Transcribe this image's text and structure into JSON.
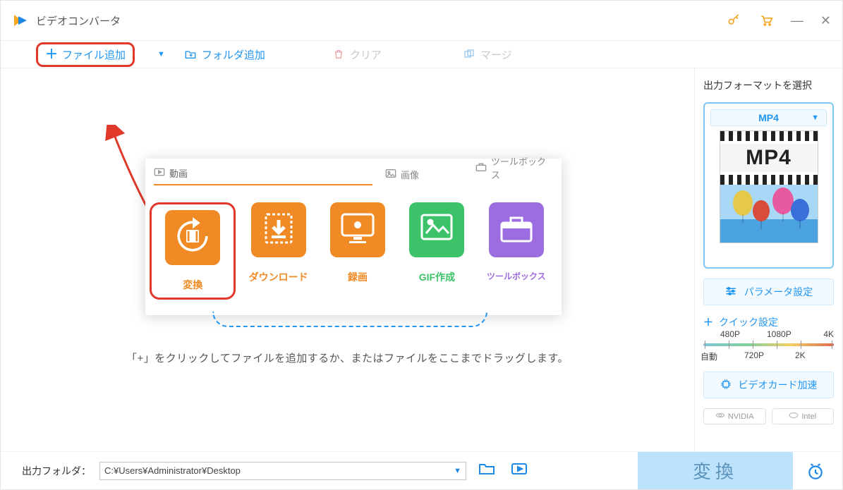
{
  "window": {
    "title": "ビデオコンバータ"
  },
  "toolbar": {
    "add_file": "ファイル追加",
    "add_folder": "フォルダ追加",
    "clear": "クリア",
    "merge": "マージ"
  },
  "hero": {
    "tabs": {
      "video": "動画",
      "image": "画像",
      "tools": "ツールボックス"
    },
    "items": {
      "convert": "変換",
      "download": "ダウンロード",
      "record": "録画",
      "gif": "GIF作成",
      "toolbox": "ツールボックス"
    },
    "caption": "「+」をクリックしてファイルを追加するか、またはファイルをここまでドラッグします。"
  },
  "sidebar": {
    "title": "出力フォーマットを選択",
    "format_selected": "MP4",
    "thumb_label": "MP4",
    "param_button": "パラメータ設定",
    "quick_title": "クイック設定",
    "scale": {
      "top": [
        "480P",
        "1080P",
        "4K"
      ],
      "bottom": [
        "自動",
        "720P",
        "2K"
      ]
    },
    "gpu_button": "ビデオカード加速",
    "gpu_vendors": [
      "NVIDIA",
      "Intel"
    ]
  },
  "footer": {
    "label": "出力フォルダ：",
    "path": "C:¥Users¥Administrator¥Desktop",
    "convert": "変換"
  }
}
